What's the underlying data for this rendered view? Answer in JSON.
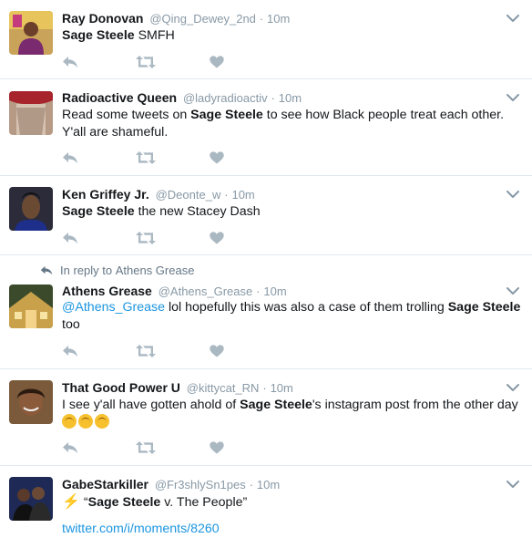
{
  "tweets": [
    {
      "name": "Ray Donovan",
      "handle": "@Qing_Dewey_2nd",
      "sep": "·",
      "time": "10m",
      "text_parts": [
        {
          "bold": "Sage Steele"
        },
        {
          "plain": " SMFH"
        }
      ],
      "avatar": "person-avatar"
    },
    {
      "name": "Radioactive Queen",
      "handle": "@ladyradioactiv",
      "sep": "·",
      "time": "10m",
      "line1_pre": "Read some tweets on ",
      "line1_bold": "Sage Steele",
      "line1_post": " to see how Black people treat each other.",
      "line2": "Y'all are shameful.",
      "avatar": "person-avatar"
    },
    {
      "name": "Ken Griffey Jr.",
      "handle": "@Deonte_w",
      "sep": "·",
      "time": "10m",
      "bold": "Sage Steele",
      "post": " the new Stacey Dash",
      "avatar": "person-avatar"
    },
    {
      "reply_prefix": "In reply to",
      "reply_to": "Athens Grease",
      "name": "Athens Grease",
      "handle": "@Athens_Grease",
      "sep": "·",
      "time": "10m",
      "mention": "@Athens_Grease",
      "mid": " lol hopefully this was also a case of them trolling ",
      "bold": "Sage Steele",
      "line2": "too",
      "avatar": "house-avatar"
    },
    {
      "name": "That Good Power U",
      "handle": "@kittycat_RN",
      "sep": "·",
      "time": "10m",
      "pre": "I see y'all have gotten ahold of ",
      "bold": "Sage Steele",
      "post": "'s instagram post from the other day",
      "emojis": [
        "upside-down-face-emoji",
        "upside-down-face-emoji",
        "upside-down-face-emoji"
      ],
      "avatar": "person-avatar"
    },
    {
      "name": "GabeStarkiller",
      "handle": "@Fr3shlySn1pes",
      "sep": "·",
      "time": "10m",
      "bolt": "⚡",
      "open_quote": "“",
      "bold": "Sage Steele",
      "post": " v. The People”",
      "link": "twitter.com/i/moments/8260",
      "avatar": "person-avatar"
    }
  ],
  "colors": {
    "accent": "#1b95e0",
    "muted": "#8899a6",
    "icon": "#aab8c2",
    "divider": "#e1e8ed"
  },
  "icons": {
    "reply": "reply-icon",
    "retweet": "retweet-icon",
    "like": "heart-icon",
    "caret": "chevron-down-icon"
  }
}
